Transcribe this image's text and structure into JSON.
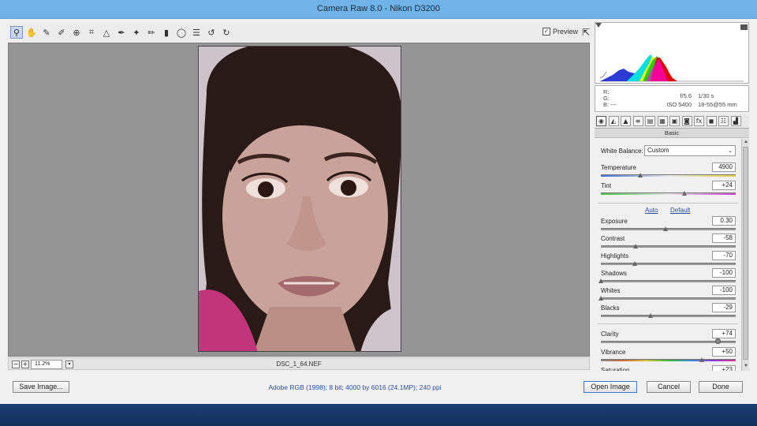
{
  "window": {
    "title": "Camera Raw 8.0  -  Nikon D3200"
  },
  "toolbar": {
    "tools": [
      {
        "icon": "zoom-icon",
        "glyph": "⚲"
      },
      {
        "icon": "hand-icon",
        "glyph": "✋"
      },
      {
        "icon": "white-balance-icon",
        "glyph": "✎"
      },
      {
        "icon": "color-sampler-icon",
        "glyph": "✐"
      },
      {
        "icon": "targeted-adjustment-icon",
        "glyph": "⊕"
      },
      {
        "icon": "crop-icon",
        "glyph": "⌗"
      },
      {
        "icon": "straighten-icon",
        "glyph": "△"
      },
      {
        "icon": "spot-removal-icon",
        "glyph": "✒"
      },
      {
        "icon": "red-eye-icon",
        "glyph": "✦"
      },
      {
        "icon": "adjustment-brush-icon",
        "glyph": "✏"
      },
      {
        "icon": "graduated-filter-icon",
        "glyph": "▮"
      },
      {
        "icon": "radial-filter-icon",
        "glyph": "◯"
      },
      {
        "icon": "preferences-icon",
        "glyph": "☰"
      },
      {
        "icon": "rotate-left-icon",
        "glyph": "↺"
      },
      {
        "icon": "rotate-right-icon",
        "glyph": "↻"
      }
    ],
    "preview_label": "Preview",
    "preview_checked": "✓",
    "fullscreen_glyph": "⇱"
  },
  "statusbar": {
    "zoom_value": "11.2%",
    "filename": "DSC_1_64.NEF",
    "zoom_out": "−",
    "zoom_in": "+",
    "dropdown": "▾"
  },
  "caminfo": {
    "rgb": [
      "R:",
      "G:",
      "B:  ---"
    ],
    "col1": [
      "f/5.6",
      "ISO 5400"
    ],
    "col2": [
      "1/30 s",
      "18-55@55 mm"
    ]
  },
  "panel": {
    "tabs": [
      {
        "icon": "basic-tab-icon",
        "glyph": "◉"
      },
      {
        "icon": "tone-curve-tab-icon",
        "glyph": "◭"
      },
      {
        "icon": "detail-tab-icon",
        "glyph": "▲"
      },
      {
        "icon": "hsl-tab-icon",
        "glyph": "≡"
      },
      {
        "icon": "split-toning-tab-icon",
        "glyph": "▤"
      },
      {
        "icon": "lens-corrections-tab-icon",
        "glyph": "▦"
      },
      {
        "icon": "effects-tab-icon",
        "glyph": "▣"
      },
      {
        "icon": "camera-calibration-tab-icon",
        "glyph": "◙"
      },
      {
        "icon": "fx-tab-icon",
        "glyph": "fx"
      },
      {
        "icon": "camera-profile-tab-icon",
        "glyph": "◼"
      },
      {
        "icon": "presets-tab-icon",
        "glyph": "☷"
      },
      {
        "icon": "snapshots-tab-icon",
        "glyph": "▟"
      }
    ],
    "title": "Basic",
    "white_balance_label": "White Balance:",
    "white_balance_value": "Custom",
    "auto_label": "Auto",
    "default_label": "Default",
    "wb_sliders": [
      {
        "label": "Temperature",
        "value": "4900",
        "position": 0.29,
        "track": "temp"
      },
      {
        "label": "Tint",
        "value": "+24",
        "position": 0.62,
        "track": "tint"
      }
    ],
    "tone_sliders": [
      {
        "label": "Exposure",
        "value": "0.30",
        "position": 0.48
      },
      {
        "label": "Contrast",
        "value": "-58",
        "position": 0.26
      },
      {
        "label": "Highlights",
        "value": "-70",
        "position": 0.25
      },
      {
        "label": "Shadows",
        "value": "-100",
        "position": 0.0
      },
      {
        "label": "Whites",
        "value": "-100",
        "position": 0.0
      },
      {
        "label": "Blacks",
        "value": "-29",
        "position": 0.37
      }
    ],
    "presence_sliders": [
      {
        "label": "Clarity",
        "value": "+74",
        "position": 0.87,
        "style": "dot"
      },
      {
        "label": "Vibrance",
        "value": "+50",
        "position": 0.75,
        "track": "vibrance"
      },
      {
        "label": "Saturation",
        "value": "+23",
        "position": 0.6,
        "track": "saturation"
      }
    ]
  },
  "bottom": {
    "save_label": "Save Image...",
    "workflow": "Adobe RGB (1998); 8 bit; 4000 by 6016 (24.1MP); 240 ppi",
    "open_label": "Open Image",
    "cancel_label": "Cancel",
    "done_label": "Done"
  },
  "colors": {
    "titlebar": "#6fb3e8",
    "canvas": "#959595",
    "link": "#2c4fa0",
    "desktop": "#1b3f73"
  }
}
